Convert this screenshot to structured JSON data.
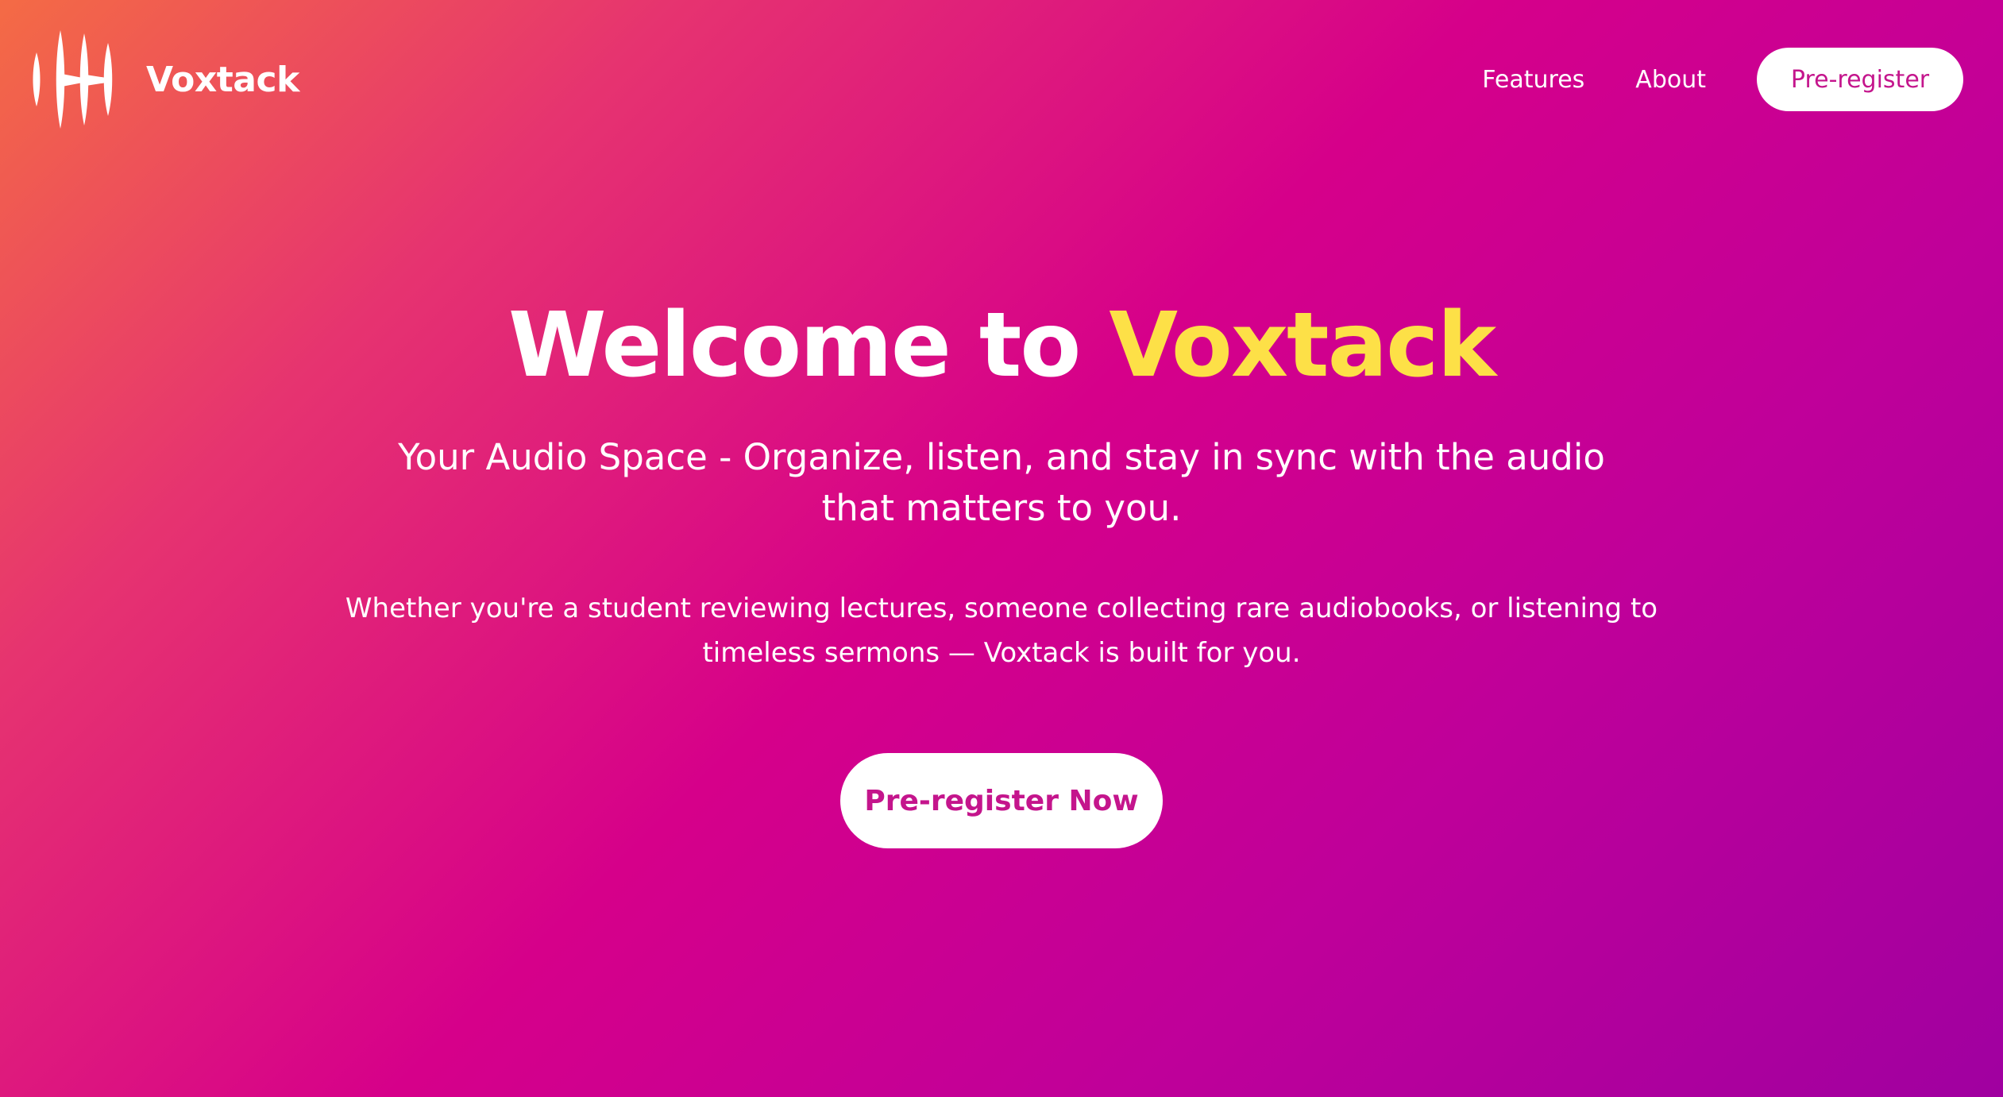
{
  "header": {
    "logo_text": "Voxtack",
    "logo_icon": "sound-wave-icon",
    "nav": {
      "features_label": "Features",
      "about_label": "About",
      "cta_label": "Pre-register"
    }
  },
  "hero": {
    "title_prefix": "Welcome to ",
    "title_brand": "Voxtack",
    "subtitle": "Your Audio Space - Organize, listen, and stay in sync with the audio that matters to you.",
    "body": "Whether you're a student reviewing lectures, someone collecting rare audiobooks, or listening to timeless sermons — Voxtack is built for you.",
    "cta_label": "Pre-register Now"
  },
  "colors": {
    "gradient_start": "#f46b45",
    "gradient_mid": "#d6008a",
    "gradient_end": "#a000a0",
    "brand_highlight": "#fde047",
    "cta_text": "#c4158c",
    "text": "#ffffff"
  }
}
